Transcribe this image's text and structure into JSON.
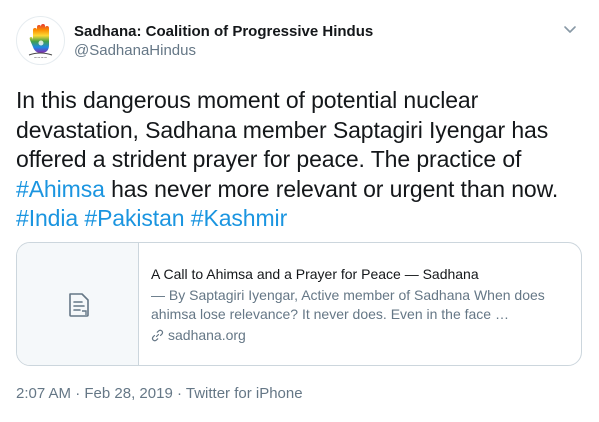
{
  "author": {
    "display_name": "Sadhana: Coalition of Progressive Hindus",
    "handle": "@SadhanaHindus",
    "avatar_icon": "rainbow-hand-icon"
  },
  "menu": {
    "caret_icon": "chevron-down-icon"
  },
  "tweet": {
    "segments": [
      {
        "text": "In this dangerous moment of potential nuclear devastation, Sadhana member Saptagiri Iyengar has offered a strident prayer for peace. The practice of ",
        "type": "text"
      },
      {
        "text": "#Ahimsa",
        "type": "hashtag"
      },
      {
        "text": " has never more relevant or urgent than now. ",
        "type": "text"
      },
      {
        "text": "#India",
        "type": "hashtag"
      },
      {
        "text": " ",
        "type": "text"
      },
      {
        "text": "#Pakistan",
        "type": "hashtag"
      },
      {
        "text": " ",
        "type": "text"
      },
      {
        "text": "#Kashmir",
        "type": "hashtag"
      }
    ]
  },
  "card": {
    "title": "A Call to Ahimsa and a Prayer for Peace — Sadhana",
    "description": "— By Saptagiri Iyengar, Active member of Sadhana When does ahimsa lose relevance? It never does. Even in the face …",
    "domain": "sadhana.org",
    "thumb_icon": "document-icon"
  },
  "meta": {
    "time": "2:07 AM",
    "separator": " · ",
    "date": "Feb 28, 2019",
    "source": "Twitter for iPhone"
  },
  "colors": {
    "hashtag": "#1b95e0",
    "secondary_text": "#657786",
    "primary_text": "#14171a",
    "border": "#ccd6dd"
  }
}
